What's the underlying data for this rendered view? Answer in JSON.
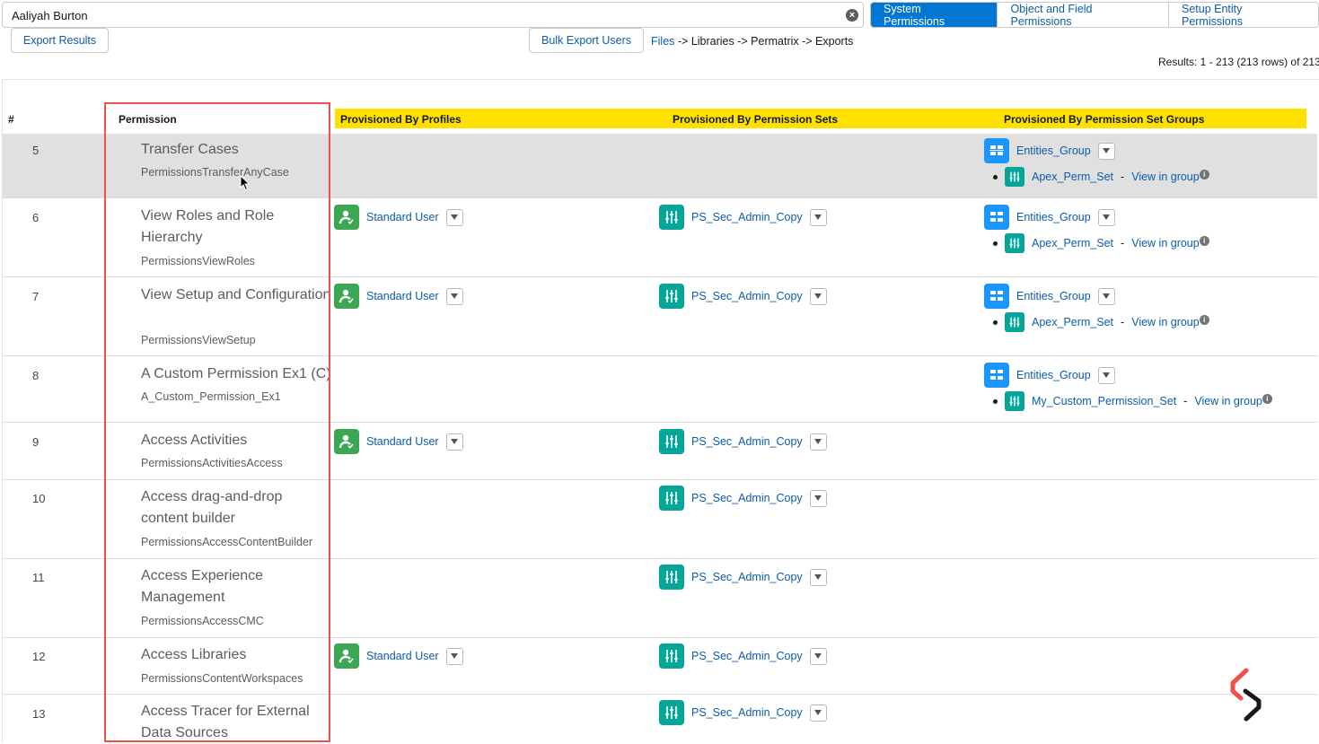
{
  "search": {
    "value": "Aaliyah Burton"
  },
  "tabs": [
    {
      "label": "System Permissions",
      "active": true
    },
    {
      "label": "Object and Field Permissions",
      "active": false
    },
    {
      "label": "Setup Entity Permissions",
      "active": false
    }
  ],
  "toolbar": {
    "export_label": "Export Results",
    "bulk_export_label": "Bulk Export Users",
    "breadcrumb_link": "Files",
    "breadcrumb_rest": " -> Libraries -> Permatrix -> Exports",
    "results_text": "Results: 1 - 213 (213 rows) of 213"
  },
  "table": {
    "col_hash": "#",
    "col_permission": "Permission",
    "col_profiles": "Provisioned By Profiles",
    "col_permsets": "Provisioned By Permission Sets",
    "col_groups": "Provisioned By Permission Set Groups",
    "view_in_group": "View in group",
    "rows": [
      {
        "num": "5",
        "title": "Transfer Cases",
        "api": "PermissionsTransferAnyCase",
        "profile": "",
        "permset": "",
        "group": "Entities_Group",
        "group_member": "Apex_Perm_Set"
      },
      {
        "num": "6",
        "title": "View Roles and Role Hierarchy",
        "api": "PermissionsViewRoles",
        "profile": "Standard User",
        "permset": "PS_Sec_Admin_Copy",
        "group": "Entities_Group",
        "group_member": "Apex_Perm_Set"
      },
      {
        "num": "7",
        "title": "View Setup and Configuration",
        "api": "PermissionsViewSetup",
        "profile": "Standard User",
        "permset": "PS_Sec_Admin_Copy",
        "group": "Entities_Group",
        "group_member": "Apex_Perm_Set"
      },
      {
        "num": "8",
        "title": "A Custom Permission Ex1 (C)",
        "api": "A_Custom_Permission_Ex1",
        "profile": "",
        "permset": "",
        "group": "Entities_Group",
        "group_member": "My_Custom_Permission_Set"
      },
      {
        "num": "9",
        "title": "Access Activities",
        "api": "PermissionsActivitiesAccess",
        "profile": "Standard User",
        "permset": "PS_Sec_Admin_Copy",
        "group": "",
        "group_member": ""
      },
      {
        "num": "10",
        "title": "Access drag-and-drop content builder",
        "api": "PermissionsAccessContentBuilder",
        "profile": "",
        "permset": "PS_Sec_Admin_Copy",
        "group": "",
        "group_member": ""
      },
      {
        "num": "11",
        "title": "Access Experience Management",
        "api": "PermissionsAccessCMC",
        "profile": "",
        "permset": "PS_Sec_Admin_Copy",
        "group": "",
        "group_member": ""
      },
      {
        "num": "12",
        "title": "Access Libraries",
        "api": "PermissionsContentWorkspaces",
        "profile": "Standard User",
        "permset": "PS_Sec_Admin_Copy",
        "group": "",
        "group_member": ""
      },
      {
        "num": "13",
        "title": "Access Tracer for External Data Sources",
        "api": "",
        "profile": "",
        "permset": "PS_Sec_Admin_Copy",
        "group": "",
        "group_member": ""
      }
    ]
  }
}
